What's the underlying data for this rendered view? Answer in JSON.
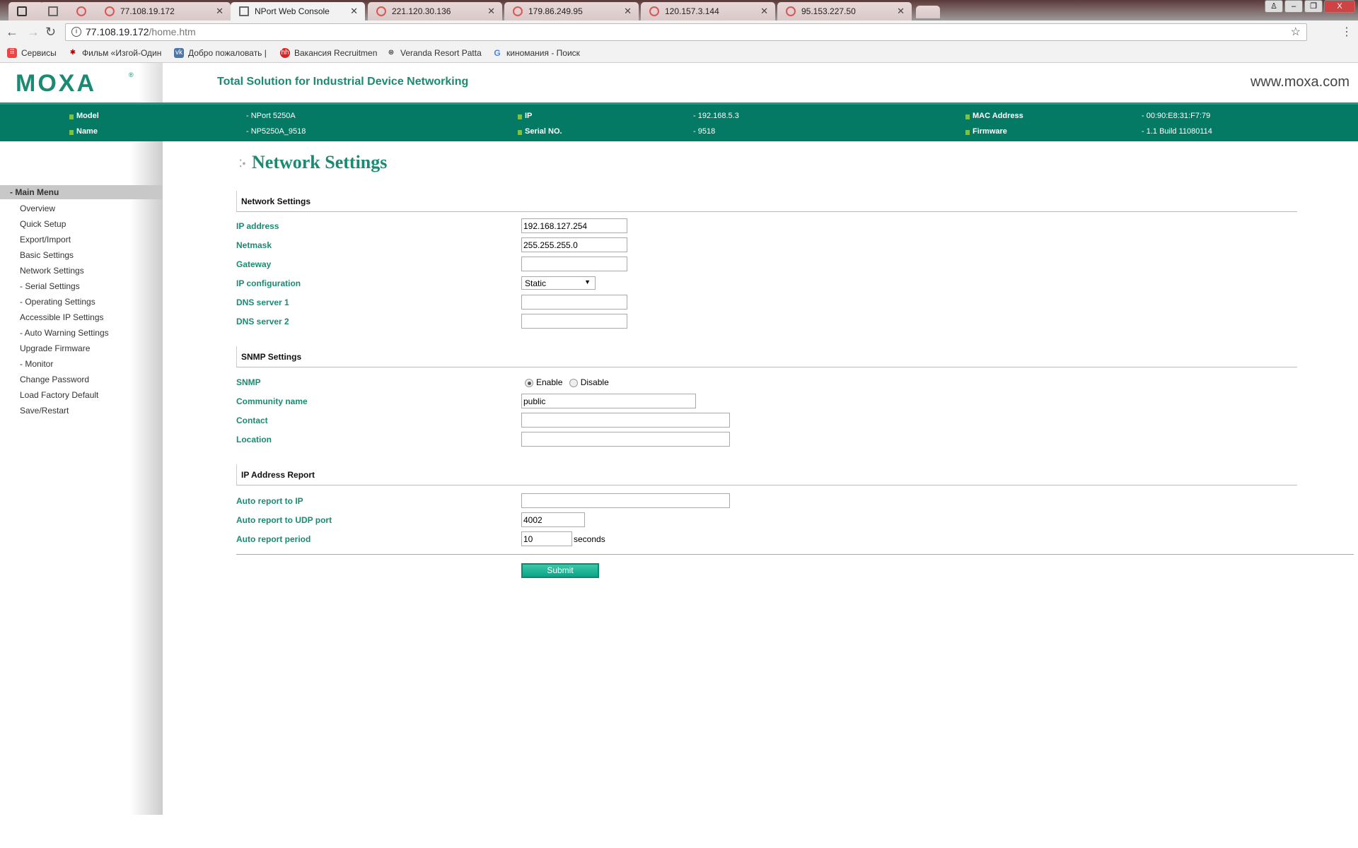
{
  "browser": {
    "tabs": [
      {
        "label": "",
        "icon": "app-icon"
      },
      {
        "label": "",
        "icon": "page-icon"
      },
      {
        "label": "",
        "icon": "site-icon"
      },
      {
        "label": "77.108.19.172",
        "icon": "site-icon"
      },
      {
        "label": "NPort Web Console",
        "icon": "page-icon",
        "active": true
      },
      {
        "label": "221.120.30.136",
        "icon": "site-icon"
      },
      {
        "label": "179.86.249.95",
        "icon": "site-icon"
      },
      {
        "label": "120.157.3.144",
        "icon": "site-icon"
      },
      {
        "label": "95.153.227.50",
        "icon": "site-icon"
      }
    ],
    "url_host": "77.108.19.172",
    "url_path": "/home.htm",
    "bookmarks": [
      "Сервисы",
      "Фильм «Изгой-Один",
      "Добро пожаловать |",
      "Вакансия Recruitmen",
      "Veranda Resort Patta",
      "киномания - Поиск"
    ]
  },
  "header": {
    "logo": "MOXA",
    "tagline": "Total Solution for Industrial Device Networking",
    "website": "www.moxa.com"
  },
  "device": {
    "model_label": "Model",
    "model": "- NPort 5250A",
    "name_label": "Name",
    "name": "- NP5250A_9518",
    "ip_label": "IP",
    "ip": "- 192.168.5.3",
    "serial_label": "Serial NO.",
    "serial": "- 9518",
    "mac_label": "MAC Address",
    "mac": "- 00:90:E8:31:F7:79",
    "firmware_label": "Firmware",
    "firmware": "- 1.1 Build 11080114"
  },
  "sidebar": {
    "title": "- Main Menu",
    "items": [
      "Overview",
      "Quick Setup",
      "Export/Import",
      "Basic Settings",
      "Network Settings",
      "- Serial Settings",
      "- Operating Settings",
      "Accessible IP Settings",
      "- Auto Warning Settings",
      "Upgrade Firmware",
      "- Monitor",
      "Change Password",
      "Load Factory Default",
      "Save/Restart"
    ]
  },
  "page": {
    "title": "Network Settings",
    "network": {
      "heading": "Network Settings",
      "ip_label": "IP address",
      "ip": "192.168.127.254",
      "netmask_label": "Netmask",
      "netmask": "255.255.255.0",
      "gateway_label": "Gateway",
      "gateway": "",
      "ipconfig_label": "IP configuration",
      "ipconfig": "Static",
      "dns1_label": "DNS server 1",
      "dns1": "",
      "dns2_label": "DNS server 2",
      "dns2": ""
    },
    "snmp": {
      "heading": "SNMP Settings",
      "snmp_label": "SNMP",
      "enable": "Enable",
      "disable": "Disable",
      "selected": "Enable",
      "community_label": "Community name",
      "community": "public",
      "contact_label": "Contact",
      "contact": "",
      "location_label": "Location",
      "location": ""
    },
    "report": {
      "heading": "IP Address Report",
      "ip_label": "Auto report to IP",
      "ip": "",
      "udp_label": "Auto report to UDP port",
      "udp": "4002",
      "period_label": "Auto report period",
      "period": "10",
      "period_unit": "seconds"
    },
    "submit": "Submit"
  }
}
